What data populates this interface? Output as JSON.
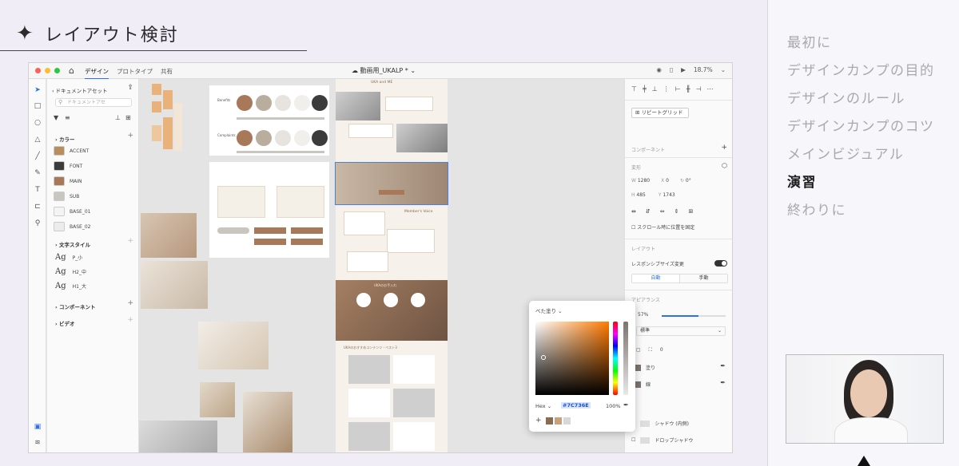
{
  "slide": {
    "title": "レイアウト検討",
    "agenda": [
      "最初に",
      "デザインカンプの目的",
      "デザインのルール",
      "デザインカンプのコツ",
      "メインビジュアル",
      "演習",
      "終わりに"
    ],
    "active_index": 5
  },
  "app": {
    "tabs": [
      "デザイン",
      "プロトタイプ",
      "共有"
    ],
    "document_title": "動画用_UKALP *",
    "zoom": "18.7%",
    "assets": {
      "header": "ドキュメントアセット",
      "search_placeholder": "ドキュメントアセ",
      "colors_label": "カラー",
      "colors": [
        {
          "name": "ACCENT",
          "hex": "#b98e5f"
        },
        {
          "name": "FONT",
          "hex": "#3c3c3c"
        },
        {
          "name": "MAIN",
          "hex": "#a8785a"
        },
        {
          "name": "SUB",
          "hex": "#c9c6c0"
        },
        {
          "name": "BASE_01",
          "hex": "#f4f4f4"
        },
        {
          "name": "BASE_02",
          "hex": "#ececec"
        }
      ],
      "text_styles_label": "文字スタイル",
      "text_styles": [
        "P_小",
        "H2_中",
        "H1_大"
      ],
      "components_label": "コンポーネント",
      "video_label": "ビデオ"
    },
    "props": {
      "repeat_grid": "リピートグリッド",
      "component": "コンポーネント",
      "transform": "変形",
      "w": "1280",
      "x": "0",
      "rotation": "0°",
      "h": "485",
      "y": "1743",
      "fix_on_scroll": "スクロール時に位置を固定",
      "layout": "レイアウト",
      "responsive_resize": "レスポンシブサイズ変更",
      "auto": "自動",
      "manual": "手動",
      "appearance": "アピアランス",
      "opacity": "57%",
      "blend": "標準",
      "corner": "0",
      "fill": "塗り",
      "border": "線",
      "inner_shadow": "シャドウ (内側)",
      "drop_shadow": "ドロップシャドウ"
    },
    "color_picker": {
      "mode": "べた塗り",
      "format": "Hex",
      "hex": "#7C736E",
      "alpha": "100%",
      "swatches": [
        "#8a6a50",
        "#c8a07c",
        "#d8d8d8"
      ]
    },
    "canvas": {
      "texts": [
        "UKA and ME",
        "Member's Voice",
        "UKAのお手入れ",
        "UKAのおすすめコンテンツ・ベスト3",
        "Benefits",
        "Complaints"
      ]
    }
  },
  "colors": {
    "accent_blue": "#2d6ff0",
    "brown": "#a8785a"
  }
}
